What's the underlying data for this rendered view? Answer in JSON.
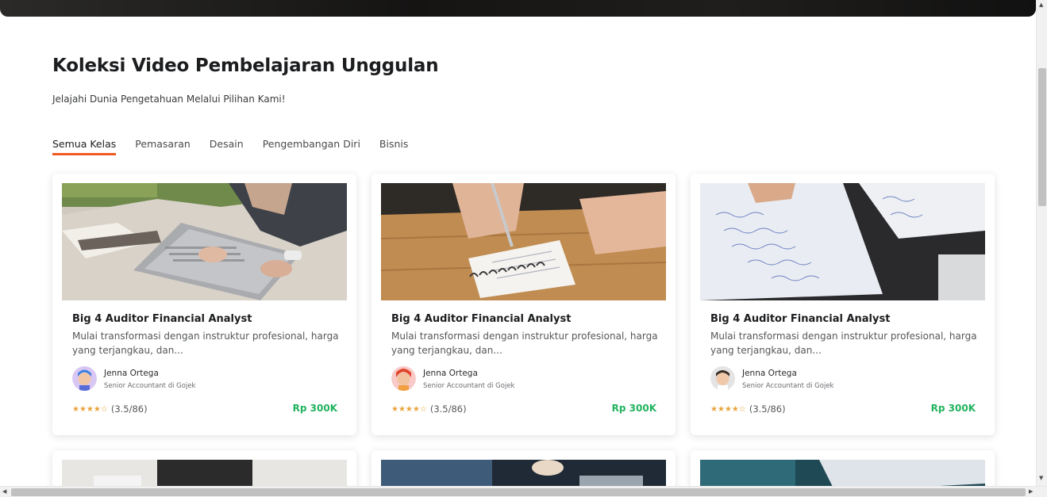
{
  "section": {
    "title": "Koleksi Video Pembelajaran Unggulan",
    "subtitle": "Jelajahi Dunia Pengetahuan Melalui Pilihan Kami!"
  },
  "tabs": [
    {
      "label": "Semua Kelas",
      "active": true
    },
    {
      "label": "Pemasaran",
      "active": false
    },
    {
      "label": "Desain",
      "active": false
    },
    {
      "label": "Pengembangan Diri",
      "active": false
    },
    {
      "label": "Bisnis",
      "active": false
    }
  ],
  "cards": [
    {
      "title": "Big 4 Auditor Financial Analyst",
      "description": "Mulai transformasi dengan instruktur profesional, harga yang terjangkau, dan...",
      "author": "Jenna Ortega",
      "role": "Senior Accountant di Gojek",
      "stars": "★★★★☆",
      "rating": "(3.5/86)",
      "price": "Rp 300K",
      "thumbnail": "laptop-on-blanket-photo",
      "avatar": "avatar-blue-hair"
    },
    {
      "title": "Big 4 Auditor Financial Analyst",
      "description": "Mulai transformasi dengan instruktur profesional, harga yang terjangkau, dan...",
      "author": "Jenna Ortega",
      "role": "Senior Accountant di Gojek",
      "stars": "★★★★☆",
      "rating": "(3.5/86)",
      "price": "Rp 300K",
      "thumbnail": "writing-notepad-photo",
      "avatar": "avatar-red-hair"
    },
    {
      "title": "Big 4 Auditor Financial Analyst",
      "description": "Mulai transformasi dengan instruktur profesional, harga yang terjangkau, dan...",
      "author": "Jenna Ortega",
      "role": "Senior Accountant di Gojek",
      "stars": "★★★★☆",
      "rating": "(3.5/86)",
      "price": "Rp 300K",
      "thumbnail": "math-paper-photo",
      "avatar": "avatar-dark-hair"
    }
  ],
  "colors": {
    "accent": "#f15a22",
    "price": "#22b35e",
    "star": "#e8a33a"
  }
}
